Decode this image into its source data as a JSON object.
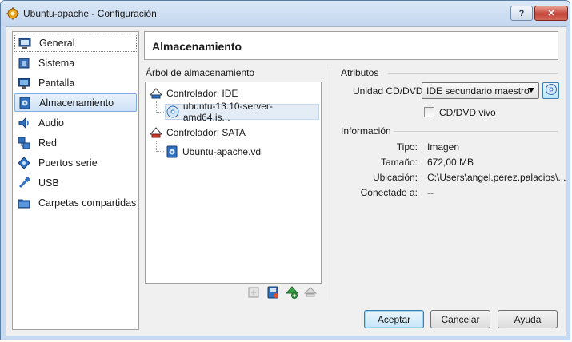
{
  "window": {
    "title": "Ubuntu-apache - Configuración",
    "help_label": "?",
    "close_label": "✕"
  },
  "sidebar": {
    "items": [
      {
        "label": "General",
        "icon": "general-icon"
      },
      {
        "label": "Sistema",
        "icon": "system-icon"
      },
      {
        "label": "Pantalla",
        "icon": "display-icon"
      },
      {
        "label": "Almacenamiento",
        "icon": "storage-icon",
        "selected": true
      },
      {
        "label": "Audio",
        "icon": "audio-icon"
      },
      {
        "label": "Red",
        "icon": "network-icon"
      },
      {
        "label": "Puertos serie",
        "icon": "serial-port-icon"
      },
      {
        "label": "USB",
        "icon": "usb-icon"
      },
      {
        "label": "Carpetas compartidas",
        "icon": "shared-folder-icon"
      }
    ]
  },
  "header": {
    "title": "Almacenamiento"
  },
  "storage_tree": {
    "label": "Árbol de almacenamiento",
    "controllers": [
      {
        "name": "Controlador: IDE",
        "attachments": [
          {
            "name": "ubuntu-13.10-server-amd64.is...",
            "type": "cd-dvd",
            "selected": true
          }
        ]
      },
      {
        "name": "Controlador: SATA",
        "attachments": [
          {
            "name": "Ubuntu-apache.vdi",
            "type": "hard-disk"
          }
        ]
      }
    ],
    "toolbar": [
      "add-controller-icon",
      "add-attachment-icon",
      "add-optical-icon",
      "remove-attachment-icon"
    ]
  },
  "attributes": {
    "title": "Atributos",
    "cd_label": "Unidad CD/DVD:",
    "cd_value": "IDE secundario maestro",
    "live_cd_label": "CD/DVD vivo",
    "live_cd_checked": false
  },
  "information": {
    "title": "Información",
    "rows": [
      {
        "key": "Tipo:",
        "value": "Imagen"
      },
      {
        "key": "Tamaño:",
        "value": "672,00 MB"
      },
      {
        "key": "Ubicación:",
        "value": "C:\\Users\\angel.perez.palacios\\..."
      },
      {
        "key": "Conectado a:",
        "value": "--"
      }
    ]
  },
  "buttons": {
    "accept": "Aceptar",
    "cancel": "Cancelar",
    "help": "Ayuda"
  }
}
